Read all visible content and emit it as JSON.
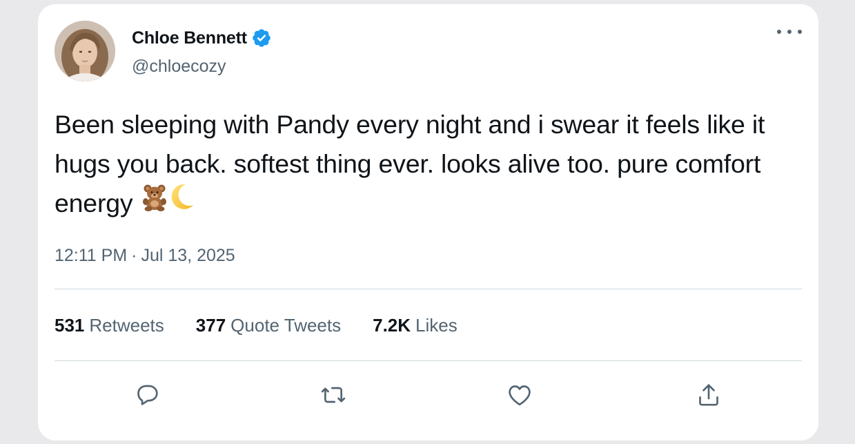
{
  "author": {
    "display_name": "Chloe Bennett",
    "handle": "@chloecozy",
    "verified": true,
    "verified_color": "#1d9bf0"
  },
  "tweet": {
    "text": "Been sleeping with Pandy every night and i swear it feels like it hugs you back. softest thing ever. looks alive too. pure comfort energy",
    "emoji": [
      "teddy-bear-emoji",
      "crescent-moon-emoji"
    ],
    "time": "12:11 PM",
    "separator": "·",
    "date": "Jul 13, 2025"
  },
  "stats": {
    "retweets_count": "531",
    "retweets_label": "Retweets",
    "quotes_count": "377",
    "quotes_label": "Quote Tweets",
    "likes_count": "7.2K",
    "likes_label": "Likes"
  },
  "actions": [
    "reply-icon",
    "retweet-icon",
    "like-icon",
    "share-icon"
  ],
  "colors": {
    "text_primary": "#0f1419",
    "text_secondary": "#536471",
    "divider": "#cfd9de",
    "accent": "#1d9bf0"
  }
}
